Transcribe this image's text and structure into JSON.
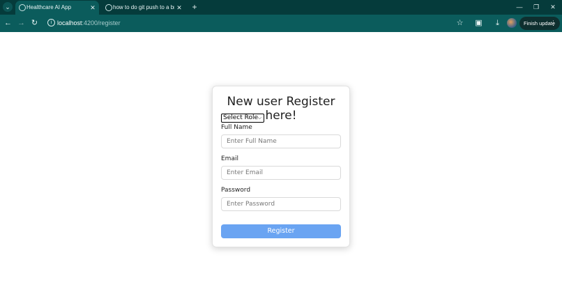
{
  "browser": {
    "tabs": [
      {
        "title": "Healthcare AI App",
        "active": true
      },
      {
        "title": "how to do git push to a branch",
        "active": false
      }
    ],
    "address": {
      "host": "localhost",
      "path": ":4200/register"
    },
    "finish_update_label": "Finish update"
  },
  "page": {
    "title": "New user Register here!",
    "role_select": {
      "selected": "Select Role"
    },
    "fields": [
      {
        "label": "Full Name",
        "placeholder": "Enter Full Name"
      },
      {
        "label": "Email",
        "placeholder": "Enter Email"
      },
      {
        "label": "Password",
        "placeholder": "Enter Password"
      }
    ],
    "submit_label": "Register"
  },
  "colors": {
    "titlebar": "#053b3b",
    "toolbar": "#0b5c5c",
    "register_button": "#6aa4f2"
  }
}
